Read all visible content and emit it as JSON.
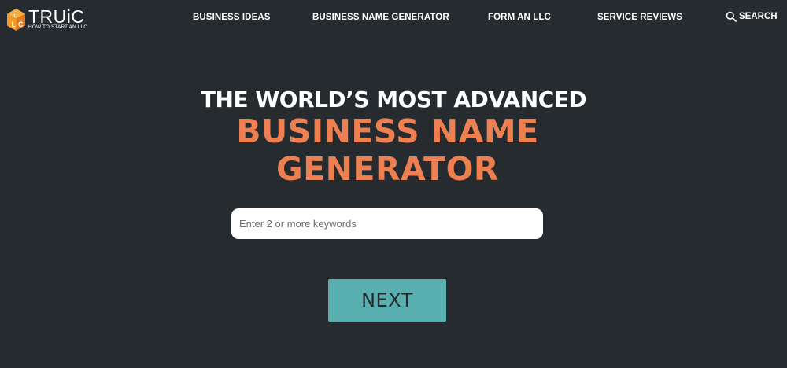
{
  "brand": {
    "name": "TRUiC",
    "tagline": "HOW TO START AN LLC",
    "colors": {
      "orange": "#ee7f51",
      "cube_light": "#f5a623",
      "cube_dark": "#e07b22"
    }
  },
  "nav": {
    "items": [
      {
        "label": "BUSINESS IDEAS"
      },
      {
        "label": "BUSINESS NAME GENERATOR"
      },
      {
        "label": "FORM AN LLC"
      },
      {
        "label": "SERVICE REVIEWS"
      }
    ],
    "search": {
      "label": "SEARCH",
      "icon": "search-icon"
    }
  },
  "hero": {
    "line1": "THE WORLD’S MOST ADVANCED",
    "line2": "BUSINESS NAME",
    "line3": "GENERATOR"
  },
  "form": {
    "keywords_placeholder": "Enter 2 or more keywords",
    "keywords_value": "",
    "next_label": "NEXT"
  },
  "theme": {
    "background": "#262b30",
    "accent": "#ee7f51",
    "button": "#59aeb0"
  }
}
